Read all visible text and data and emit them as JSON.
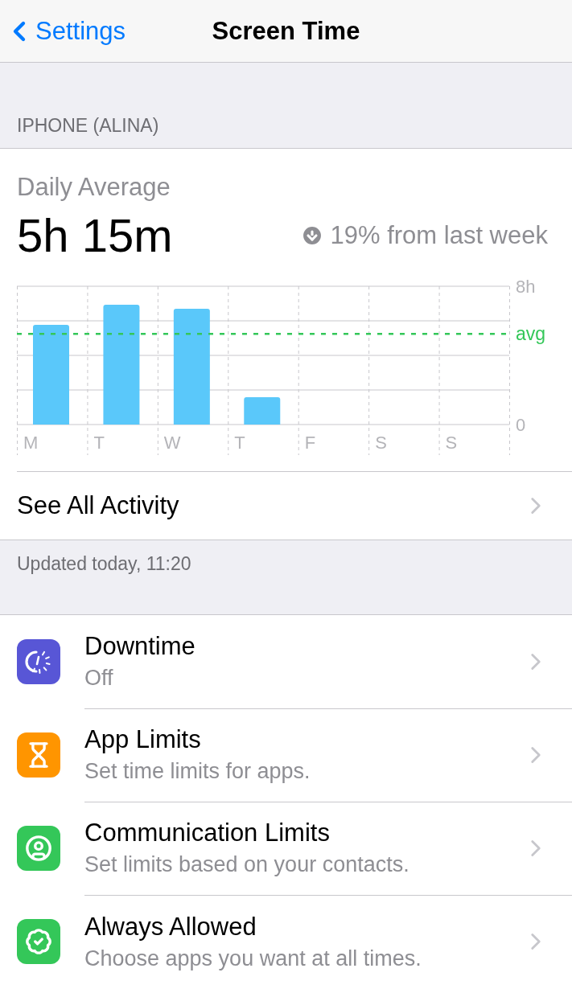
{
  "nav": {
    "back": "Settings",
    "title": "Screen Time"
  },
  "device_header": "IPHONE (ALINA)",
  "summary": {
    "label": "Daily Average",
    "value": "5h 15m",
    "trend": "19% from last week",
    "trend_decreased": true,
    "chart_data": {
      "type": "bar",
      "categories": [
        "M",
        "T",
        "W",
        "T",
        "F",
        "S",
        "S"
      ],
      "values": [
        5.77,
        6.93,
        6.7,
        1.58,
        null,
        null,
        null
      ],
      "ylim": [
        0,
        8
      ],
      "yticks": [
        {
          "value": 0,
          "label": "0"
        },
        {
          "value": 8,
          "label": "8h"
        }
      ]
    },
    "average_marker": "avg"
  },
  "see_all": "See All Activity",
  "updated": "Updated today, 11:20",
  "rows": [
    {
      "kind": "downtime",
      "title": "Downtime",
      "subtitle": "Off",
      "color": "#5856d6"
    },
    {
      "kind": "limits",
      "title": "App Limits",
      "subtitle": "Set time limits for apps.",
      "color": "#ff9500"
    },
    {
      "kind": "contacts",
      "title": "Communication Limits",
      "subtitle": "Set limits based on your contacts.",
      "color": "#34c759"
    },
    {
      "kind": "allowed",
      "title": "Always Allowed",
      "subtitle": "Choose apps you want at all times.",
      "color": "#34c759"
    }
  ]
}
